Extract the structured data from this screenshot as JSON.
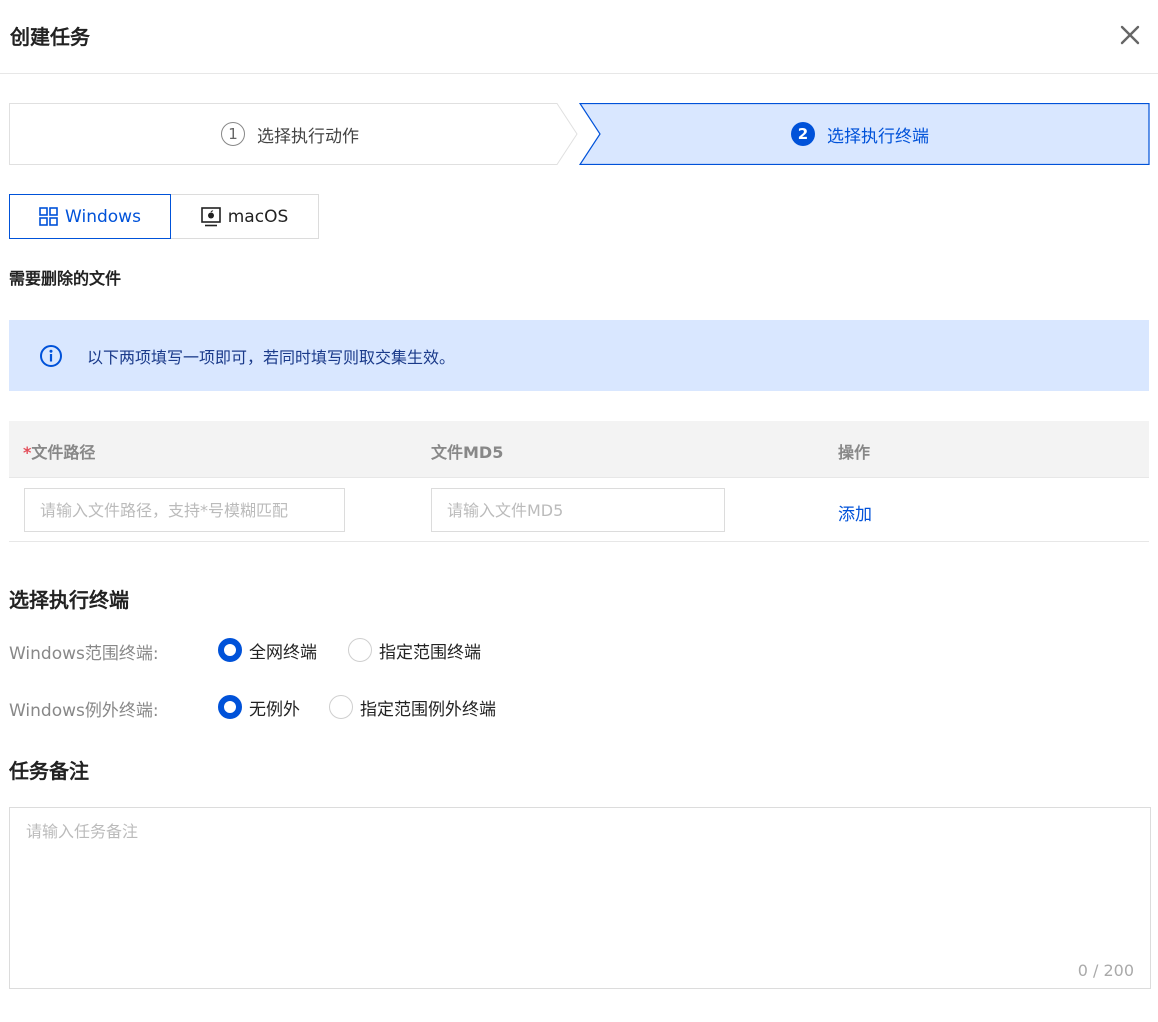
{
  "dialog": {
    "title": "创建任务"
  },
  "steps": [
    {
      "num": "1",
      "label": "选择执行动作"
    },
    {
      "num": "2",
      "label": "选择执行终端"
    }
  ],
  "os_tabs": {
    "windows": "Windows",
    "macos": "macOS"
  },
  "files_section": {
    "title": "需要删除的文件"
  },
  "info": {
    "text": "以下两项填写一项即可，若同时填写则取交集生效。"
  },
  "table": {
    "required_mark": "*",
    "col_path": "文件路径",
    "col_md5": "文件MD5",
    "col_action": "操作",
    "path_placeholder": "请输入文件路径，支持*号模糊匹配",
    "md5_placeholder": "请输入文件MD5",
    "add_label": "添加"
  },
  "terminals": {
    "title": "选择执行终端",
    "scope_label": "Windows范围终端:",
    "scope_opt_all": "全网终端",
    "scope_opt_specified": "指定范围终端",
    "except_label": "Windows例外终端:",
    "except_opt_none": "无例外",
    "except_opt_specified": "指定范围例外终端"
  },
  "remark": {
    "title": "任务备注",
    "placeholder": "请输入任务备注",
    "counter": "0 / 200"
  },
  "colors": {
    "primary": "#0052d9",
    "step_active_bg": "#d9e7ff",
    "info_bg": "#d9e7ff",
    "required": "#e34d59"
  }
}
